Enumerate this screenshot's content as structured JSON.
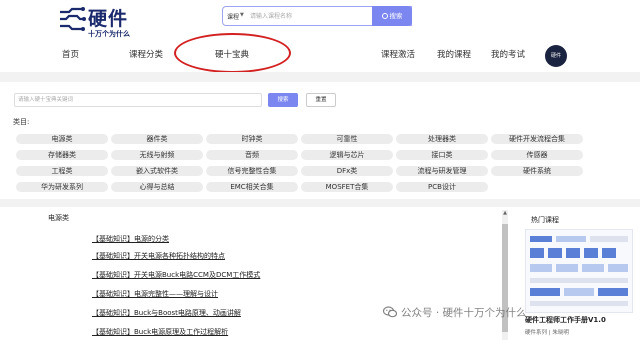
{
  "logo": {
    "title": "硬件",
    "subtitle": "十万个为什么",
    "icon": "circuit-logo-icon"
  },
  "search": {
    "category": "课程",
    "placeholder": "请输入课程名称",
    "button_label": "搜索",
    "icon": "search-icon"
  },
  "nav": {
    "items": [
      {
        "label": "首页"
      },
      {
        "label": "课程分类"
      },
      {
        "label": "硬十宝典"
      }
    ],
    "right_items": [
      {
        "label": "课程激活"
      },
      {
        "label": "我的课程"
      },
      {
        "label": "我的考试"
      }
    ],
    "avatar_text": "硬件"
  },
  "filter": {
    "placeholder": "请输入硬十宝典关键词",
    "search_label": "搜索",
    "reset_label": "重置",
    "category_label": "类目:"
  },
  "categories": [
    [
      "电源类",
      "器件类",
      "时钟类",
      "可靠性",
      "处理器类",
      "硬件开发流程合集"
    ],
    [
      "存储器类",
      "无线与射频",
      "音频",
      "逻辑与芯片",
      "接口类",
      "传感器"
    ],
    [
      "工程类",
      "嵌入式软件类",
      "信号完整性合集",
      "DFx类",
      "流程与研发管理",
      "硬件系统"
    ],
    [
      "华为研发系列",
      "心得与总结",
      "EMC相关合集",
      "MOSFET合集",
      "PCB设计"
    ]
  ],
  "content": {
    "section_title": "电源类",
    "articles": [
      "【基础知识】电源的分类",
      "【基础知识】开关电源各种拓扑结构的特点",
      "【基础知识】开关电源Buck电路CCM及DCM工作模式",
      "【基础知识】电源完整性——理解与设计",
      "【基础知识】Buck与Boost电路原理、动画讲解",
      "【基础知识】Buck电源原理及工作过程解析"
    ]
  },
  "hot": {
    "title": "热门课程",
    "course_title": "硬件工程师工作手册V1.0",
    "course_sub": "硬件系列 | 朱晓明"
  },
  "watermark": {
    "text": "公众号 · 硬件十万个为什么",
    "icon": "wechat-icon"
  }
}
